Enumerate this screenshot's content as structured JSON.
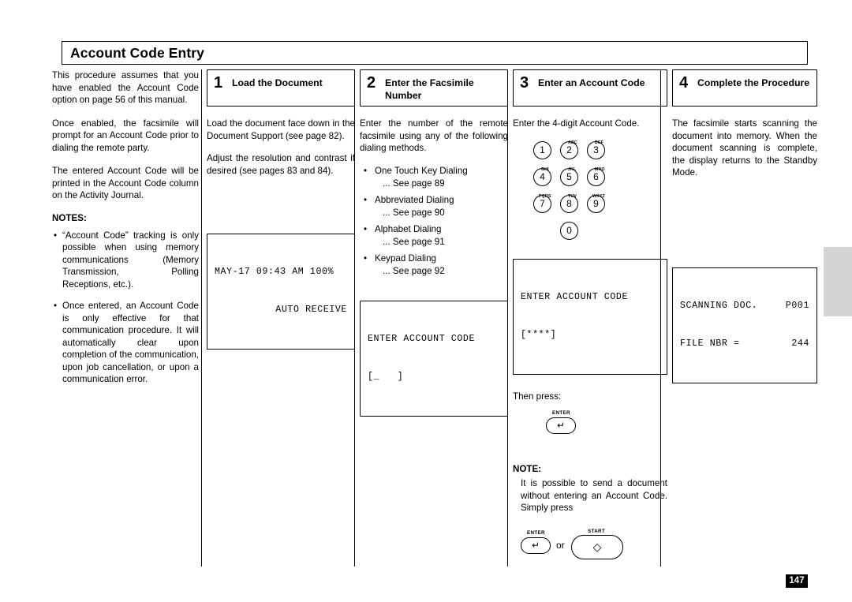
{
  "page": {
    "title": "Account Code Entry",
    "number": "147"
  },
  "intro": {
    "paragraphs": [
      "This procedure assumes that you have enabled the Account Code option on page 56 of this manual.",
      "Once enabled, the facsimile will prompt for an Account Code prior to dialing the remote party.",
      "The entered Account Code will be printed in the Account Code column on the Activity Journal."
    ],
    "notes_heading": "NOTES:",
    "notes": [
      "“Account Code” tracking is only possible when using memory communications (Memory Transmission, Polling Receptions, etc.).",
      "Once entered, an Account Code is only effective for that communication procedure. It will automatically clear upon completion of the communication, upon job cancellation, or upon a communication error."
    ]
  },
  "steps": [
    {
      "number": "1",
      "title": "Load the Document",
      "paragraphs": [
        "Load the document face down in the Document Support (see page 82).",
        "Adjust the resolution and contrast if desired (see pages 83 and 84)."
      ],
      "lcd": {
        "line1_left": "MAY-17 09:43 AM 100%",
        "line2_right": "AUTO RECEIVE"
      }
    },
    {
      "number": "2",
      "title": "Enter the Facsimile Number",
      "paragraphs": [
        "Enter the number of the remote facsimile using any of the following dialing methods."
      ],
      "dial_methods": [
        {
          "label": "One Touch Key Dialing",
          "see": "... See page 89"
        },
        {
          "label": "Abbreviated Dialing",
          "see": "... See page 90"
        },
        {
          "label": "Alphabet Dialing",
          "see": "... See page 91"
        },
        {
          "label": "Keypad Dialing",
          "see": "... See page 92"
        }
      ],
      "lcd": {
        "line1": "ENTER ACCOUNT CODE",
        "line2": "[_   ]"
      }
    },
    {
      "number": "3",
      "title": "Enter an Account Code",
      "paragraphs": [
        "Enter the 4-digit Account Code."
      ],
      "keypad": [
        {
          "digit": "1",
          "letters": ""
        },
        {
          "digit": "2",
          "letters": "ABC"
        },
        {
          "digit": "3",
          "letters": "DEF"
        },
        {
          "digit": "4",
          "letters": "GHI"
        },
        {
          "digit": "5",
          "letters": "JKL"
        },
        {
          "digit": "6",
          "letters": "MNO"
        },
        {
          "digit": "7",
          "letters": "PQRS"
        },
        {
          "digit": "8",
          "letters": "TUV"
        },
        {
          "digit": "9",
          "letters": "WXYZ"
        },
        {
          "digit": "0",
          "letters": ""
        }
      ],
      "lcd": {
        "line1": "ENTER ACCOUNT CODE",
        "line2": "[****]"
      },
      "then_press": "Then press:",
      "enter_label": "ENTER",
      "note_heading": "NOTE:",
      "note_body": "It is possible to send a document without entering an Account Code. Simply press",
      "or_label": "or",
      "start_label": "START"
    },
    {
      "number": "4",
      "title": "Complete the Procedure",
      "paragraphs": [
        "The facsimile starts scanning the document into memory. When the document scanning is complete, the display returns to the Standby Mode."
      ],
      "lcd": {
        "line1_left": "SCANNING DOC.",
        "line1_right": "P001",
        "line2_left": "FILE NBR =",
        "line2_right": "244"
      }
    }
  ]
}
